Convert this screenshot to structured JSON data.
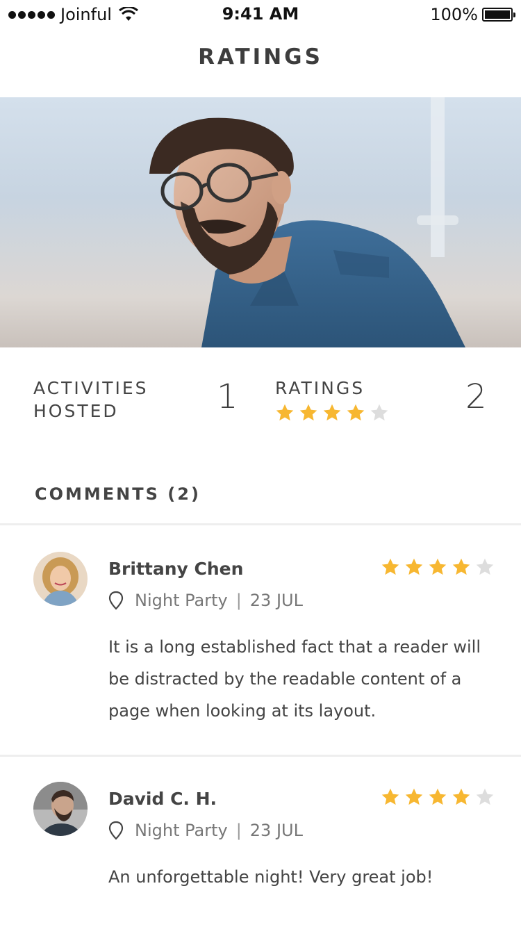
{
  "status_bar": {
    "carrier": "Joinful",
    "time": "9:41 AM",
    "battery": "100%",
    "battery_level": 1.0
  },
  "nav": {
    "title": "RATINGS"
  },
  "stats": {
    "activities_label_line1": "ACTIVITIES",
    "activities_label_line2": "HOSTED",
    "activities_value": "1",
    "ratings_label": "RATINGS",
    "ratings_value": "2",
    "ratings_stars": 4,
    "ratings_stars_max": 5
  },
  "comments": {
    "header": "COMMENTS (2)",
    "items": [
      {
        "name": "Brittany Chen",
        "activity": "Night Party",
        "date": "23 JUL",
        "stars": 4,
        "text": "It is a long established fact that a reader will be distracted by the readable content of a page when looking at its layout."
      },
      {
        "name": "David C. H.",
        "activity": "Night Party",
        "date": "23 JUL",
        "stars": 4,
        "text": "An unforgettable night! Very great job!"
      }
    ]
  },
  "colors": {
    "star_filled": "#F7B731",
    "star_empty": "#DDDDDD",
    "text_dark": "#3D3D3D",
    "divider": "#EEEEEE"
  },
  "icons": {
    "status_wifi": "wifi-icon",
    "location_pin": "location-pin-icon",
    "star": "star-icon"
  }
}
